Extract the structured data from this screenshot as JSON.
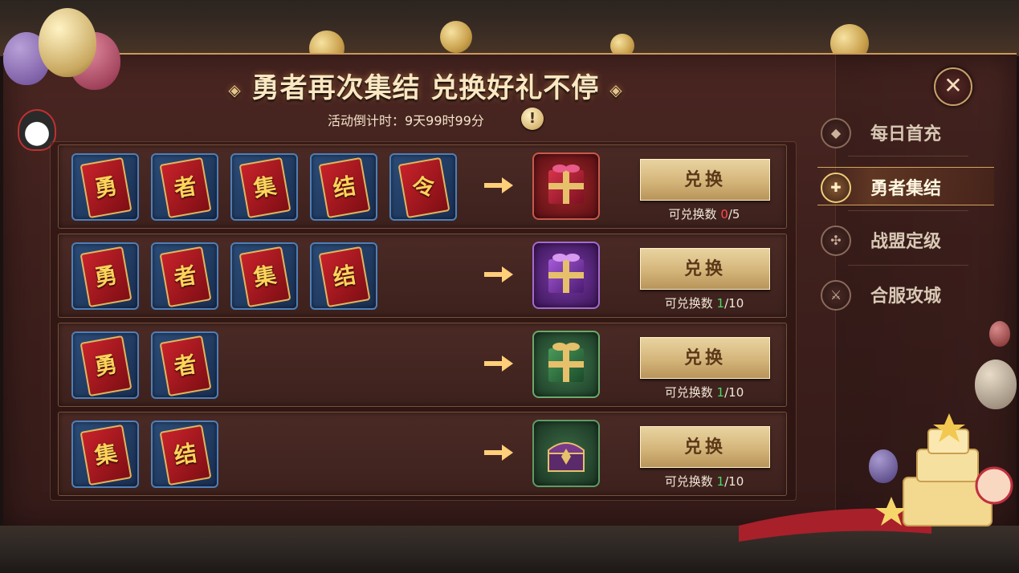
{
  "title": "勇者再次集结 兑换好礼不停",
  "title_decor": "◈",
  "countdown": "活动倒计时：9天99时99分",
  "info_icon": "!",
  "close_icon": "✕",
  "rows": [
    {
      "cards": [
        "勇",
        "者",
        "集",
        "结",
        "令"
      ],
      "reward": "red-gift-box",
      "button": "兑换",
      "count_prefix": "可兑换数 ",
      "count_cur": "0",
      "count_total": "/5"
    },
    {
      "cards": [
        "勇",
        "者",
        "集",
        "结"
      ],
      "reward": "purple-gift-box",
      "button": "兑换",
      "count_prefix": "可兑换数 ",
      "count_cur": "1",
      "count_total": "/10"
    },
    {
      "cards": [
        "勇",
        "者"
      ],
      "reward": "green-gift-box",
      "button": "兑换",
      "count_prefix": "可兑换数 ",
      "count_cur": "1",
      "count_total": "/10"
    },
    {
      "cards": [
        "集",
        "结"
      ],
      "reward": "treasure-chest",
      "button": "兑换",
      "count_prefix": "可兑换数 ",
      "count_cur": "1",
      "count_total": "/10"
    }
  ],
  "sidebar": {
    "items": [
      {
        "label": "每日首充",
        "icon": "diamond-icon",
        "active": false
      },
      {
        "label": "勇者集结",
        "icon": "puzzle-icon",
        "active": true
      },
      {
        "label": "战盟定级",
        "icon": "emblem-icon",
        "active": false
      },
      {
        "label": "合服攻城",
        "icon": "catapult-icon",
        "active": false
      }
    ]
  },
  "colors": {
    "accent": "#d4b57a",
    "count_zero": "#ff4a4a",
    "count_ok": "#4cd964",
    "panel": "#3f201d"
  }
}
